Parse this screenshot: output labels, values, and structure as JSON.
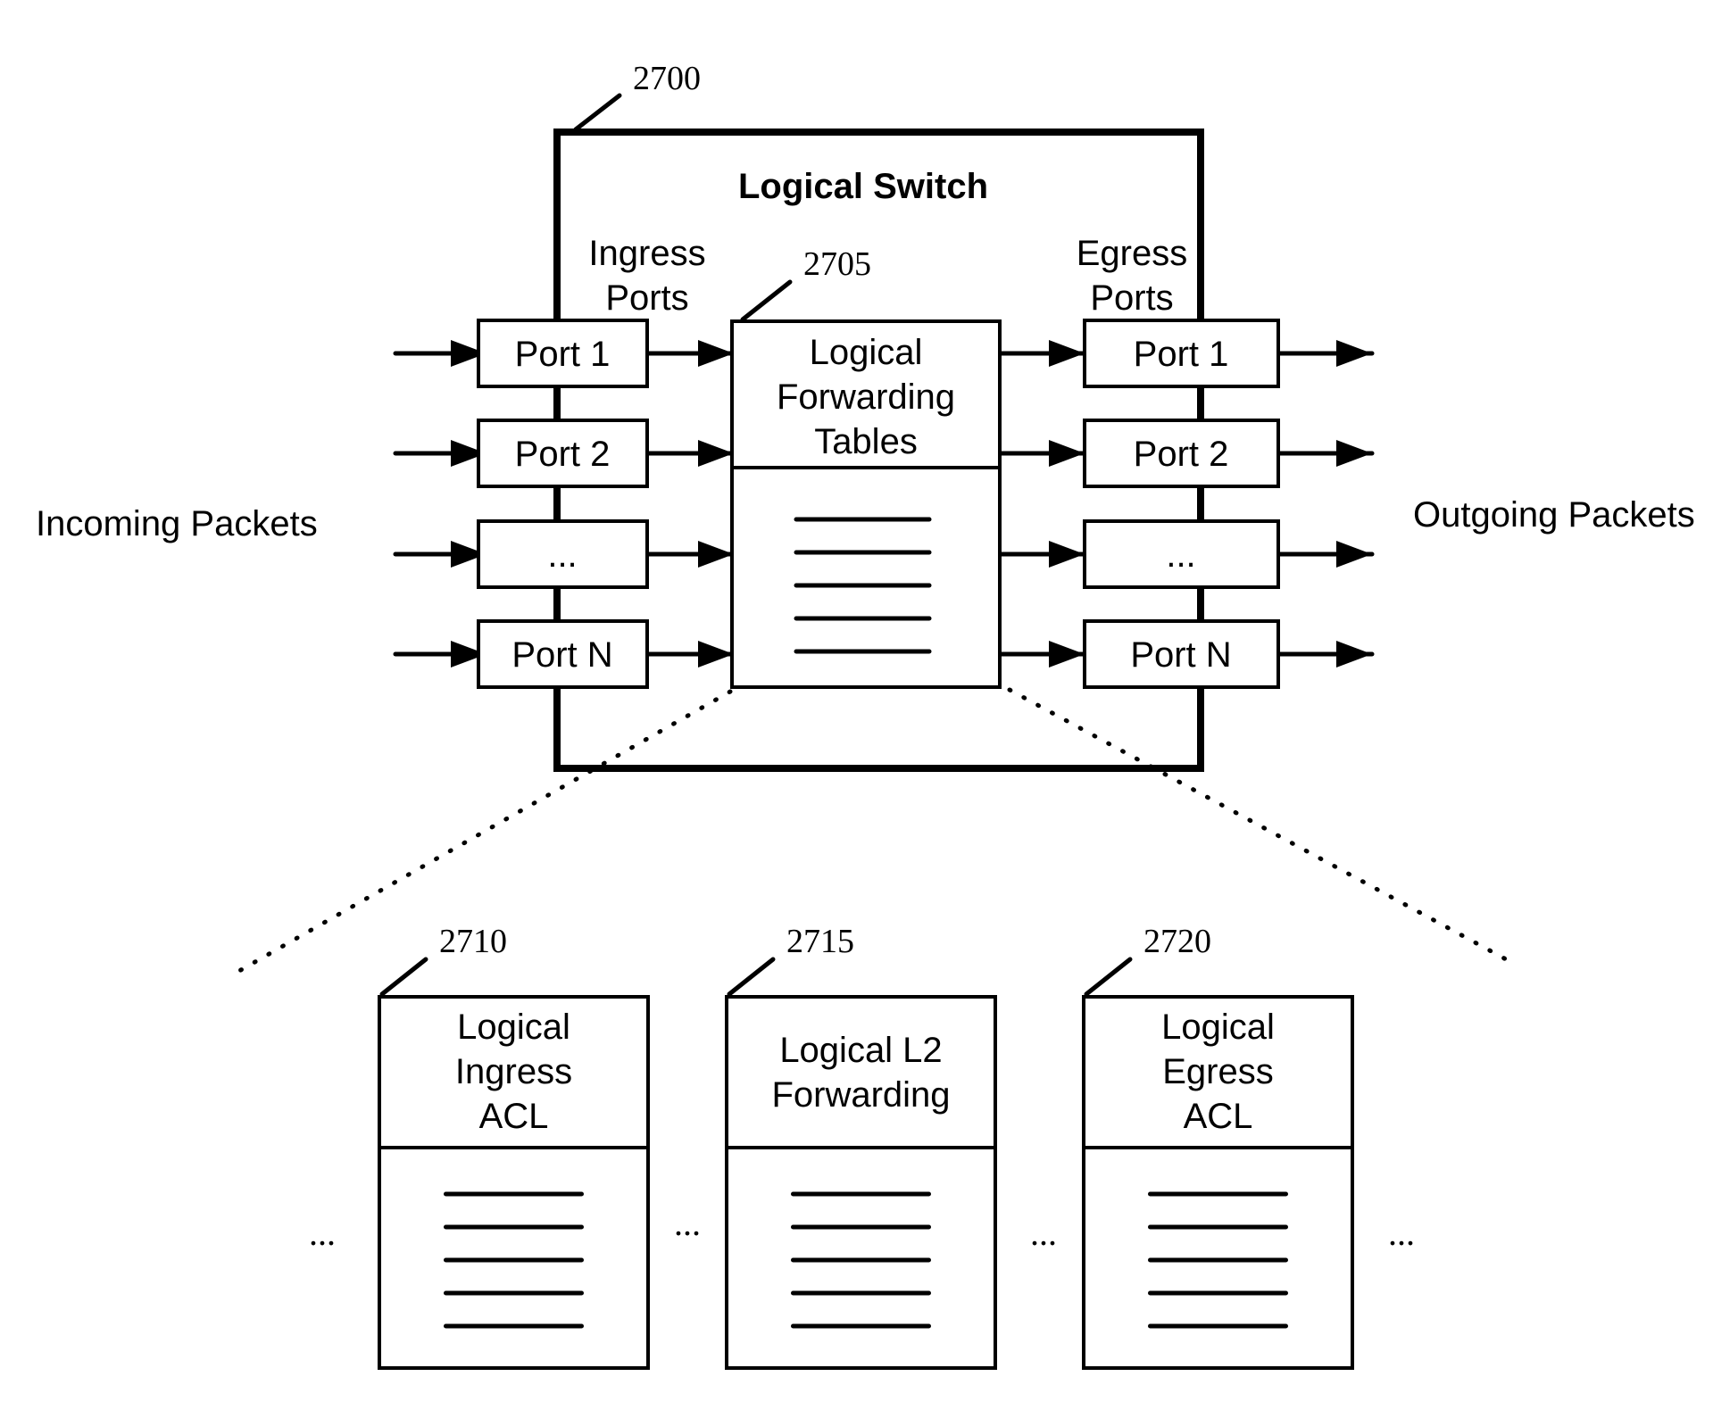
{
  "diagram": {
    "switch": {
      "ref": "2700",
      "title": "Logical Switch",
      "ingress_header": [
        "Ingress",
        "Ports"
      ],
      "egress_header": [
        "Egress",
        "Ports"
      ],
      "ingress_ports": [
        "Port 1",
        "Port 2",
        "...",
        "Port N"
      ],
      "egress_ports": [
        "Port 1",
        "Port 2",
        "...",
        "Port N"
      ]
    },
    "forwarding_tables": {
      "ref": "2705",
      "title": [
        "Logical",
        "Forwarding",
        "Tables"
      ],
      "entry_count": 5
    },
    "incoming_label": "Incoming Packets",
    "outgoing_label": "Outgoing Packets",
    "tables": [
      {
        "ref": "2710",
        "title": [
          "Logical",
          "Ingress",
          "ACL"
        ],
        "entry_count": 5
      },
      {
        "ref": "2715",
        "title": [
          "Logical L2",
          "Forwarding"
        ],
        "entry_count": 5
      },
      {
        "ref": "2720",
        "title": [
          "Logical",
          "Egress",
          "ACL"
        ],
        "entry_count": 5
      }
    ],
    "ellipses": [
      "...",
      "...",
      "...",
      "..."
    ]
  }
}
